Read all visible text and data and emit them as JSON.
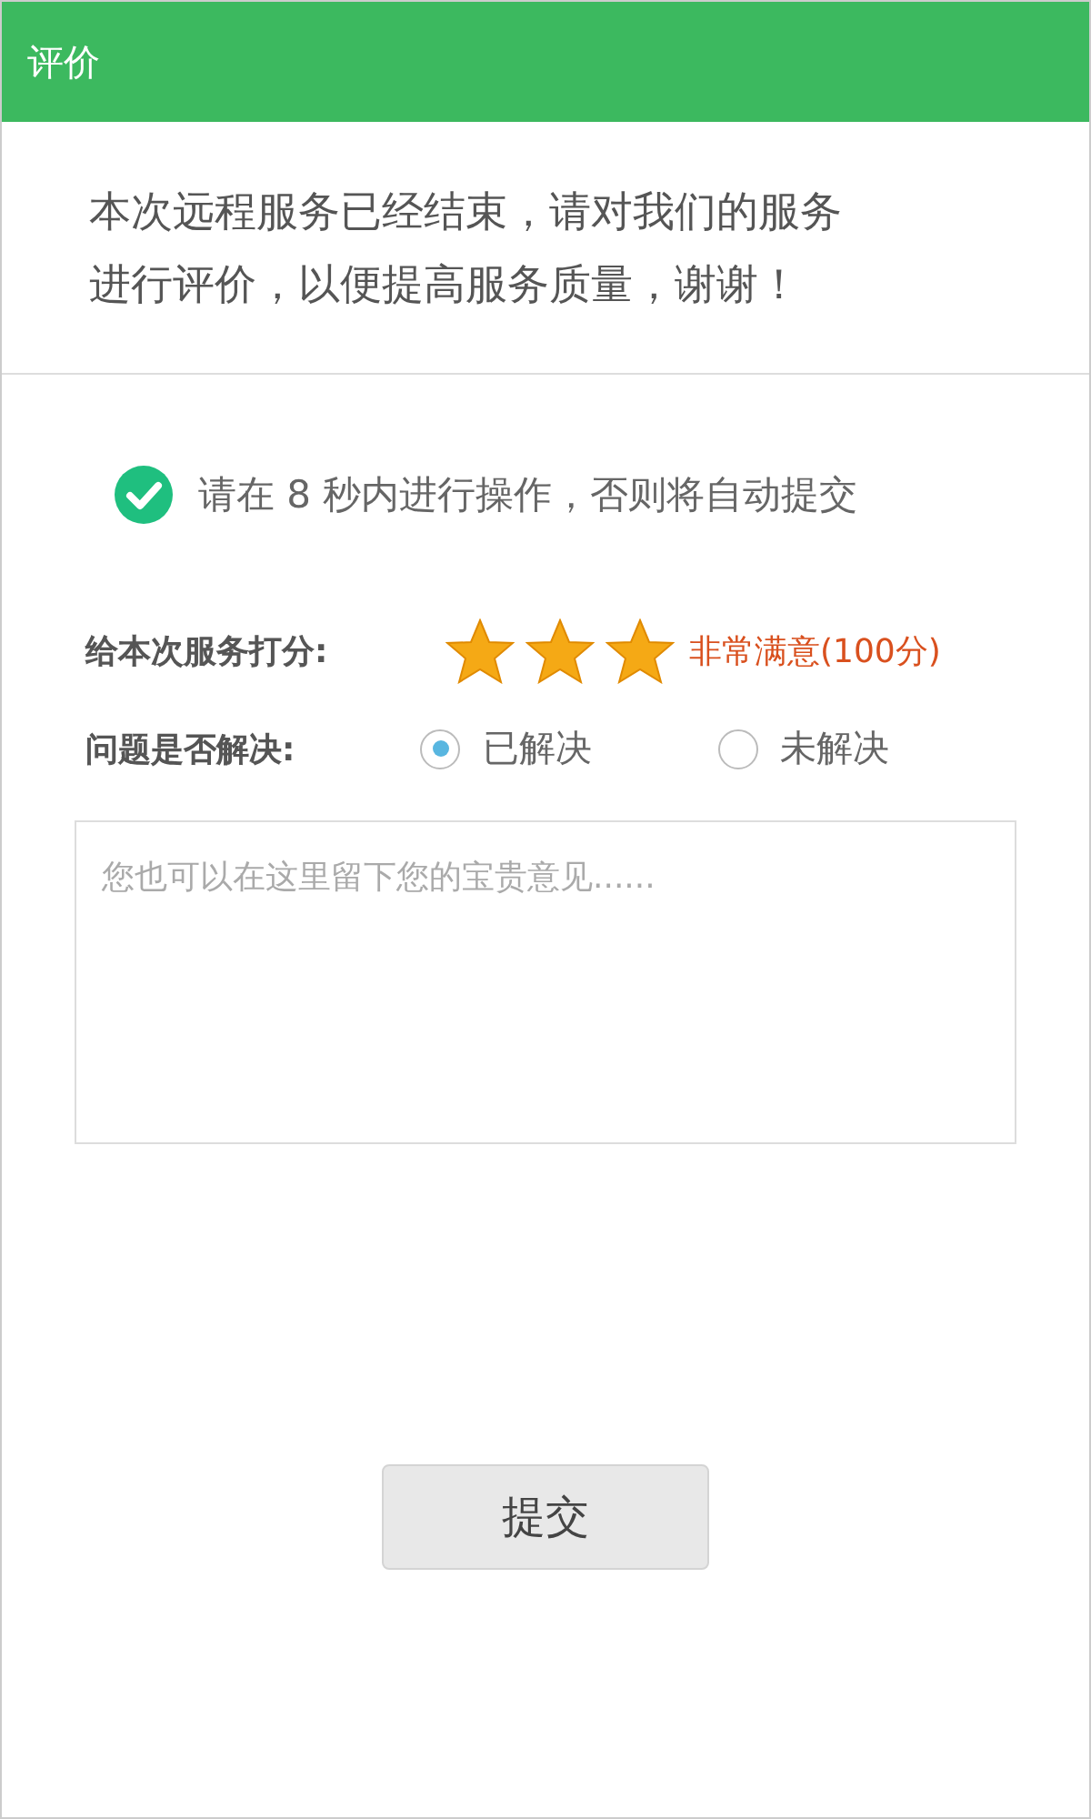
{
  "window": {
    "title": "评价"
  },
  "message": "本次远程服务已经结束，请对我们的服务进行评价，以便提高服务质量，谢谢！",
  "notice": "请在 8 秒内进行操作，否则将自动提交",
  "rating": {
    "label": "给本次服务打分:",
    "stars": 3,
    "result": "非常满意(100分)"
  },
  "resolved": {
    "label": "问题是否解决:",
    "options": [
      {
        "label": "已解决",
        "selected": true
      },
      {
        "label": "未解决",
        "selected": false
      }
    ]
  },
  "comment": {
    "placeholder": "您也可以在这里留下您的宝贵意见......"
  },
  "buttons": [
    "提交"
  ]
}
